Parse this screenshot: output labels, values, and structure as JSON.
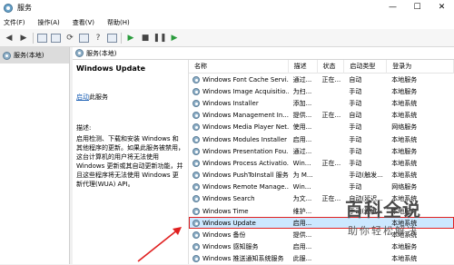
{
  "window": {
    "title": "服务",
    "minimize": "—",
    "maximize": "☐",
    "close": "✕"
  },
  "menu": [
    "文件(F)",
    "操作(A)",
    "查看(V)",
    "帮助(H)"
  ],
  "tree": {
    "item": "服务(本地)"
  },
  "panel_header": "服务(本地)",
  "description": {
    "service_name": "Windows Update",
    "start_link": "启动",
    "start_suffix": "此服务",
    "desc_label": "描述:",
    "desc_text": "启用检测、下载和安装 Windows 和其他程序的更新。如果此服务被禁用，这台计算机的用户将无法使用 Windows 更新或其自动更新功能，并且这些程序将无法使用 Windows 更新代理(WUA) API。"
  },
  "columns": [
    "名称",
    "描述",
    "状态",
    "启动类型",
    "登录为"
  ],
  "services": [
    {
      "name": "Windows Font Cache Servi...",
      "desc": "通过...",
      "status": "正在...",
      "startup": "自动",
      "logon": "本地服务"
    },
    {
      "name": "Windows Image Acquisitio...",
      "desc": "为扫...",
      "status": "",
      "startup": "手动",
      "logon": "本地服务"
    },
    {
      "name": "Windows Installer",
      "desc": "添加...",
      "status": "",
      "startup": "手动",
      "logon": "本地系统"
    },
    {
      "name": "Windows Management In...",
      "desc": "提供...",
      "status": "正在...",
      "startup": "自动",
      "logon": "本地系统"
    },
    {
      "name": "Windows Media Player Net...",
      "desc": "使用...",
      "status": "",
      "startup": "手动",
      "logon": "网络服务"
    },
    {
      "name": "Windows Modules Installer",
      "desc": "启用...",
      "status": "",
      "startup": "手动",
      "logon": "本地系统"
    },
    {
      "name": "Windows Presentation Fou...",
      "desc": "通过...",
      "status": "",
      "startup": "手动",
      "logon": "本地服务"
    },
    {
      "name": "Windows Process Activatio...",
      "desc": "Win...",
      "status": "正在...",
      "startup": "手动",
      "logon": "本地系统"
    },
    {
      "name": "Windows PushToInstall 服务",
      "desc": "为 M...",
      "status": "",
      "startup": "手动(触发...",
      "logon": "本地系统"
    },
    {
      "name": "Windows Remote Manage...",
      "desc": "Win...",
      "status": "",
      "startup": "手动",
      "logon": "网络服务"
    },
    {
      "name": "Windows Search",
      "desc": "为文...",
      "status": "正在...",
      "startup": "自动(延迟...",
      "logon": "本地系统"
    },
    {
      "name": "Windows Time",
      "desc": "维护...",
      "status": "",
      "startup": "手动(触发...",
      "logon": "本地服务"
    },
    {
      "name": "Windows Update",
      "desc": "启用...",
      "status": "",
      "startup": "",
      "logon": "本地系统"
    },
    {
      "name": "Windows 备份",
      "desc": "提供...",
      "status": "",
      "startup": "",
      "logon": "本地系统"
    },
    {
      "name": "Windows 感知服务",
      "desc": "启用...",
      "status": "",
      "startup": "",
      "logon": "本地服务"
    },
    {
      "name": "Windows 推送通知系统服务",
      "desc": "此服...",
      "status": "",
      "startup": "",
      "logon": "本地系统"
    }
  ],
  "selected_row": 12,
  "watermark": {
    "line1": "百科全说",
    "line2": "助你轻松解决"
  },
  "colors": {
    "selection_outline": "#e02020",
    "arrow": "#e02020",
    "link": "#1a5fb4"
  }
}
